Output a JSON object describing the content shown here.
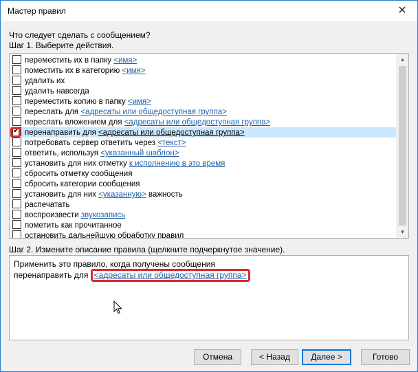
{
  "window": {
    "title": "Мастер правил",
    "close_glyph": "✕"
  },
  "question": "Что следует сделать с сообщением?",
  "step1_label": "Шаг 1. Выберите действия.",
  "actions": [
    {
      "pre": "переместить их в папку ",
      "link": "<имя>",
      "post": "",
      "checked": false
    },
    {
      "pre": "поместить их в категорию ",
      "link": "<имя>",
      "post": "",
      "checked": false
    },
    {
      "pre": "удалить их",
      "link": "",
      "post": "",
      "checked": false
    },
    {
      "pre": "удалить навсегда",
      "link": "",
      "post": "",
      "checked": false
    },
    {
      "pre": "переместить копию в папку ",
      "link": "<имя>",
      "post": "",
      "checked": false
    },
    {
      "pre": "переслать для ",
      "link": "<адресаты или общедоступная группа>",
      "post": "",
      "checked": false
    },
    {
      "pre": "переслать вложением для ",
      "link": "<адресаты или общедоступная группа>",
      "post": "",
      "checked": false
    },
    {
      "pre": "перенаправить для ",
      "link": "<адресаты или общедоступная группа>",
      "post": "",
      "checked": true
    },
    {
      "pre": "потребовать сервер ответить через ",
      "link": "<текст>",
      "post": "",
      "checked": false
    },
    {
      "pre": "ответить, используя ",
      "link": "<указанный шаблон>",
      "post": "",
      "checked": false
    },
    {
      "pre": "установить для них отметку ",
      "link": "к исполнению в это время",
      "post": "",
      "checked": false
    },
    {
      "pre": "сбросить отметку сообщения",
      "link": "",
      "post": "",
      "checked": false
    },
    {
      "pre": "сбросить категории сообщения",
      "link": "",
      "post": "",
      "checked": false
    },
    {
      "pre": "установить для них ",
      "link": "<указанную>",
      "post": " важность",
      "checked": false
    },
    {
      "pre": "распечатать",
      "link": "",
      "post": "",
      "checked": false
    },
    {
      "pre": "воспроизвести ",
      "link": "звукозапись",
      "post": "",
      "checked": false
    },
    {
      "pre": "пометить как прочитанное",
      "link": "",
      "post": "",
      "checked": false
    },
    {
      "pre": "остановить дальнейшую обработку правил",
      "link": "",
      "post": "",
      "checked": false
    }
  ],
  "step2_label": "Шаг 2. Измените описание правила (щелкните подчеркнутое значение).",
  "description": {
    "line1": "Применить это правило, когда получены сообщения",
    "line2_pre": "перенаправить для ",
    "line2_link": "<адресаты или общедоступная группа>"
  },
  "buttons": {
    "cancel": "Отмена",
    "back": "< Назад",
    "next": "Далее >",
    "finish": "Готово"
  },
  "highlight_color": "#e0282c",
  "selection_color": "#cce8ff"
}
